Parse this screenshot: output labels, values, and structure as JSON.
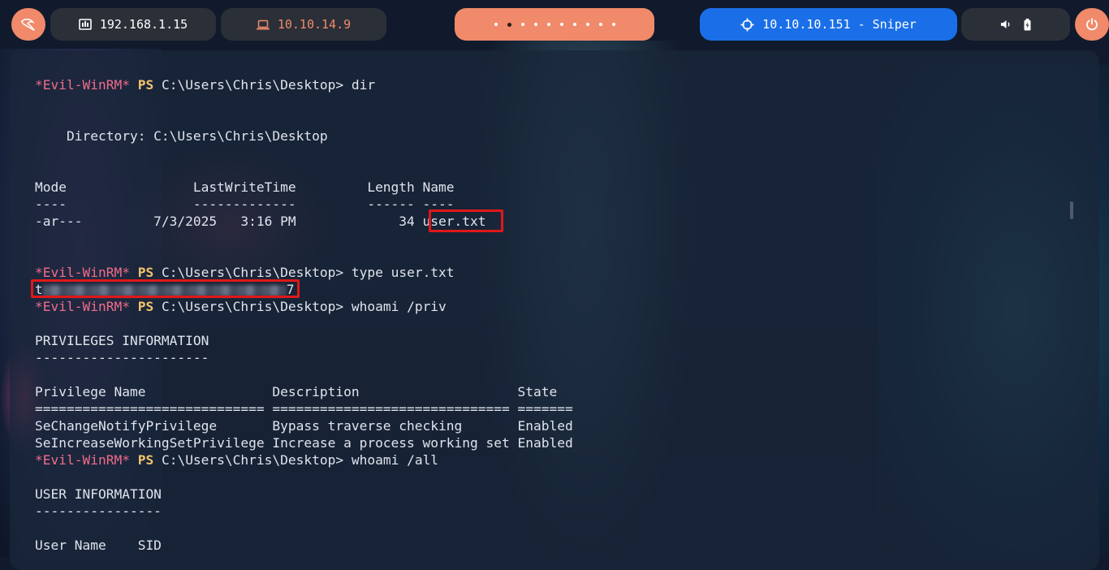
{
  "topbar": {
    "local_ip": "192.168.1.15",
    "vpn_ip": "10.10.14.9",
    "target": "10.10.10.151 - Sniper"
  },
  "colors": {
    "pill_dark": "#2b2f37",
    "pill_accent": "#f08a6a",
    "pill_target": "#1a6fe8",
    "prompt_name": "#f06c8a",
    "prompt_ps": "#f5c36c",
    "highlight_box": "#e01818"
  },
  "icons": [
    "kali-dragon-icon",
    "network-icon",
    "laptop-icon",
    "crosshair-icon",
    "volume-icon",
    "battery-icon",
    "power-icon"
  ],
  "terminal": {
    "prompt_name": "*Evil-WinRM*",
    "prompt_ps": "PS",
    "prompt_path": "C:\\Users\\Chris\\Desktop>",
    "cmd1": " dir",
    "directory": "    Directory: C:\\Users\\Chris\\Desktop",
    "dir_header": "Mode                LastWriteTime         Length Name",
    "dir_sep": "----                -------------         ------ ----",
    "dir_row_prefix": "-ar---         7/3/2025   3:16 PM             34 ",
    "dir_row_file": "user.txt",
    "cmd2": " type user.txt",
    "flag_start": "t",
    "flag_end": "7",
    "cmd3": " whoami /priv",
    "priv_title": "PRIVILEGES INFORMATION",
    "priv_title_sep": "----------------------",
    "priv_header": "Privilege Name                Description                    State",
    "priv_sep": "============================= ============================== =======",
    "priv_row1": "SeChangeNotifyPrivilege       Bypass traverse checking       Enabled",
    "priv_row2": "SeIncreaseWorkingSetPrivilege Increase a process working set Enabled",
    "cmd4": " whoami /all",
    "user_title": "USER INFORMATION",
    "user_title_sep": "----------------",
    "user_header": "User Name    SID"
  }
}
